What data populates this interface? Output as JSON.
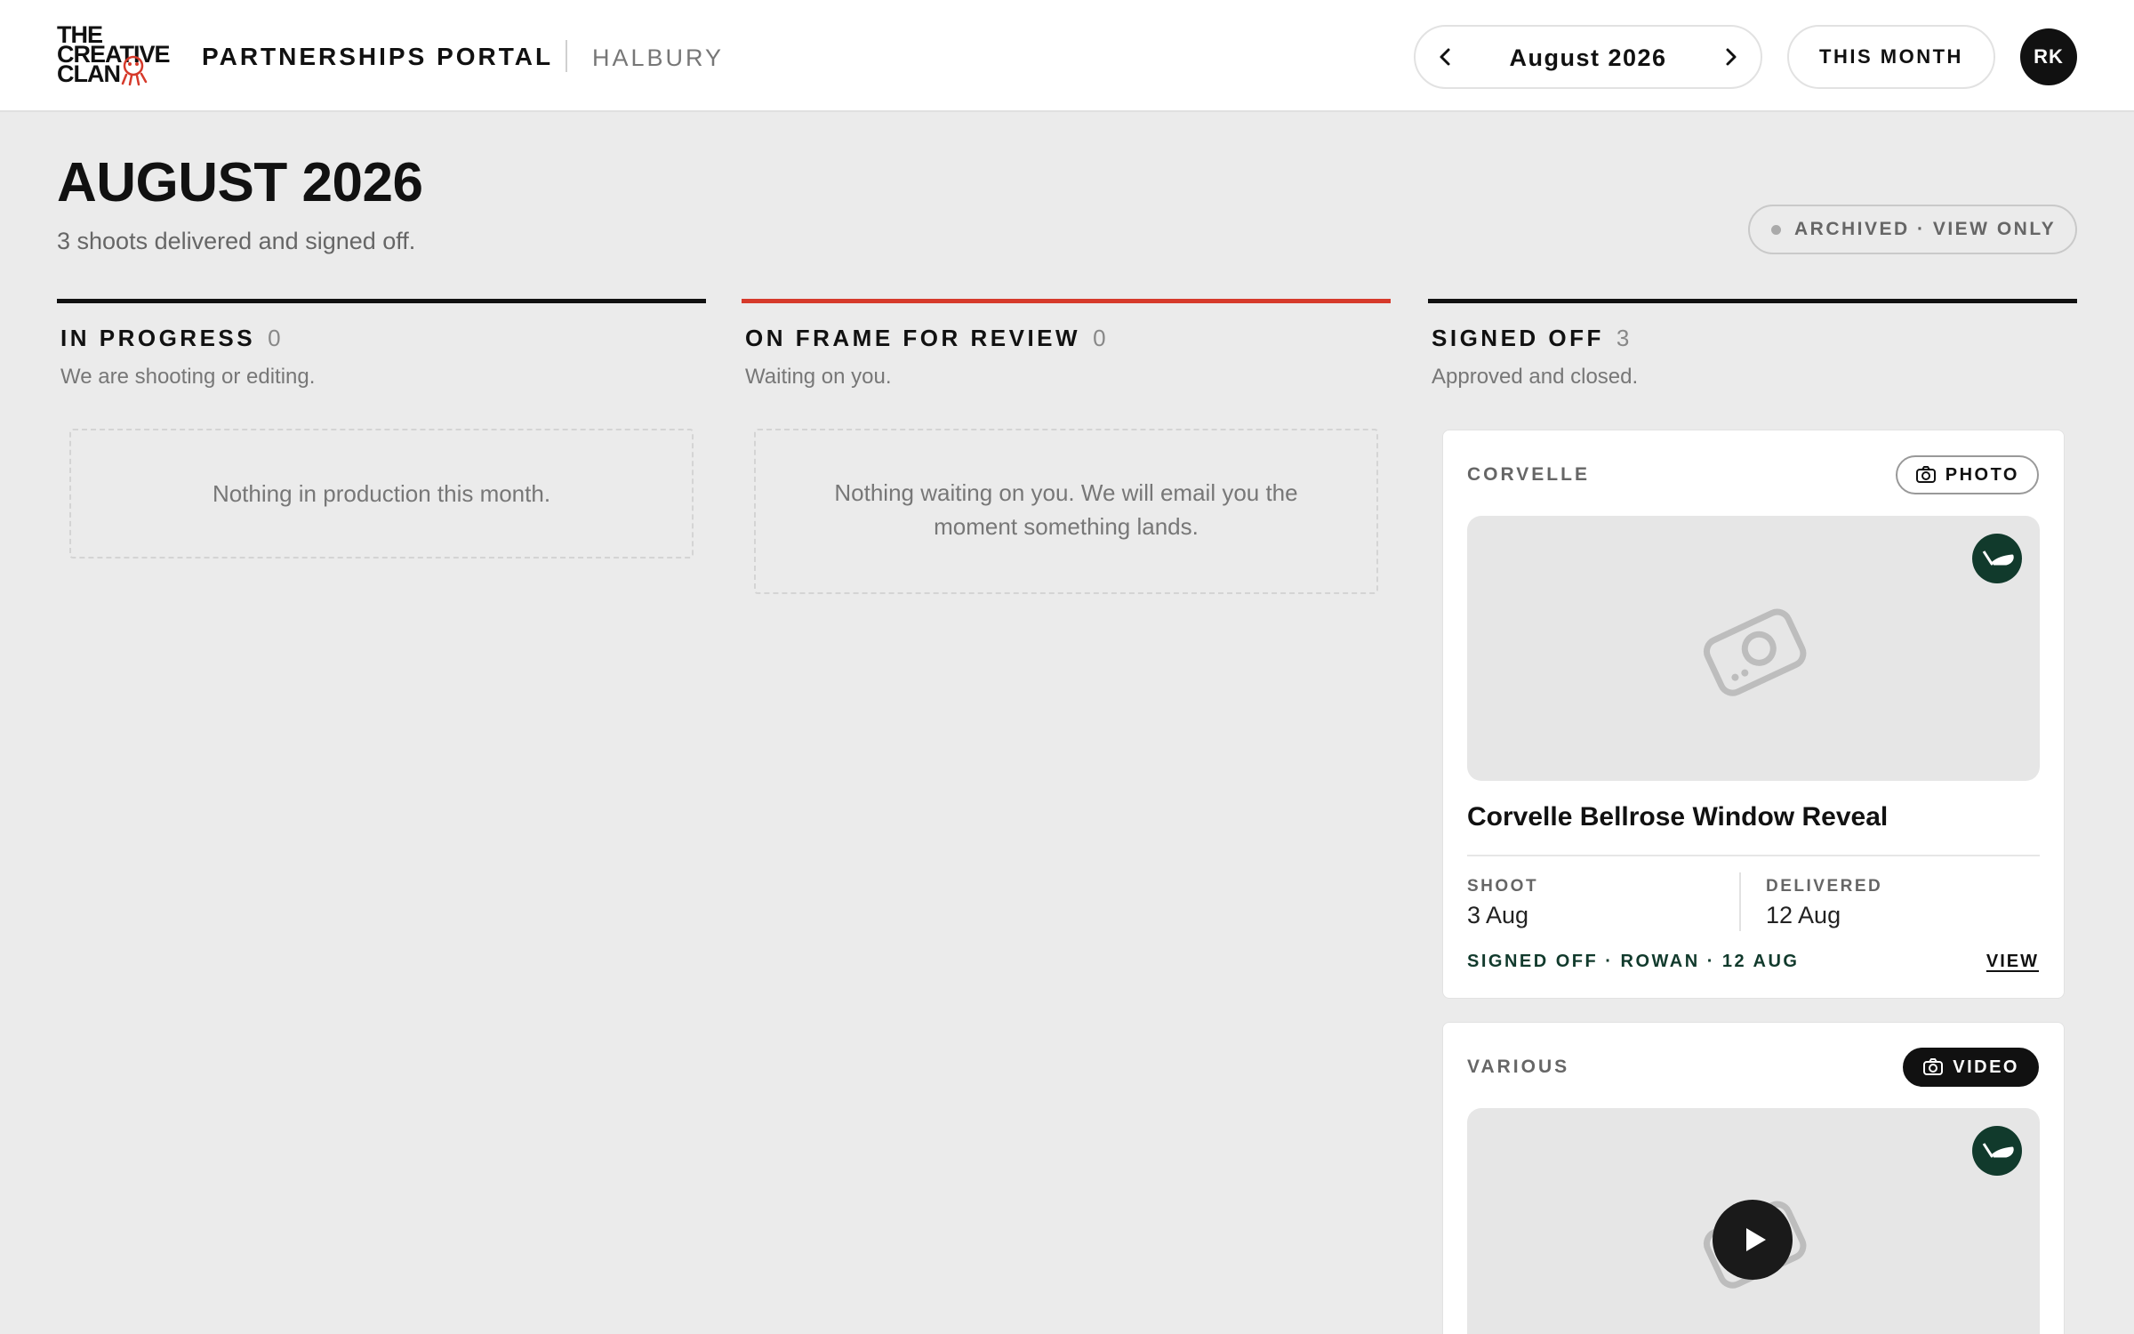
{
  "header": {
    "logo_lines": [
      "THE",
      "CREATIVE",
      "CLAN"
    ],
    "portal_title": "PARTNERSHIPS PORTAL",
    "client": "HALBURY",
    "month_label": "August 2026",
    "prev_icon": "chevron-left-icon",
    "next_icon": "chevron-right-icon",
    "this_month_label": "THIS MONTH",
    "avatar_initials": "RK"
  },
  "page": {
    "title": "AUGUST 2026",
    "subtitle": "3 shoots delivered and signed off.",
    "archived_label": "ARCHIVED · VIEW ONLY"
  },
  "columns": [
    {
      "title": "IN PROGRESS",
      "count": "0",
      "description": "We are shooting or editing.",
      "empty_text": "Nothing in production this month.",
      "accent": "#111111"
    },
    {
      "title": "ON FRAME FOR REVIEW",
      "count": "0",
      "description": "Waiting on you.",
      "empty_text": "Nothing waiting on you. We will email you the moment something lands.",
      "accent": "#d63a2b"
    },
    {
      "title": "SIGNED OFF",
      "count": "3",
      "description": "Approved and closed.",
      "accent": "#111111"
    }
  ],
  "cards": [
    {
      "client": "CORVELLE",
      "type": "PHOTO",
      "type_icon": "camera-icon",
      "thumbnail_icon": "camera-icon",
      "title": "Corvelle Bellrose Window Reveal",
      "shoot_label": "SHOOT",
      "shoot_date": "3 Aug",
      "delivered_label": "DELIVERED",
      "delivered_date": "12 Aug",
      "signoff": "SIGNED OFF · ROWAN · 12 AUG",
      "view_label": "VIEW"
    },
    {
      "client": "VARIOUS",
      "type": "VIDEO",
      "type_icon": "video-camera-icon",
      "thumbnail_icon": "play-icon"
    }
  ],
  "colors": {
    "accent_red": "#d63a2b",
    "signed_green": "#113a2c",
    "background": "#ebebeb"
  }
}
